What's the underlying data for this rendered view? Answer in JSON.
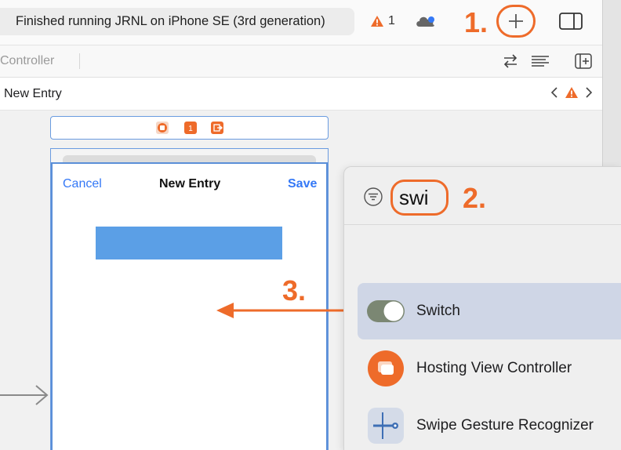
{
  "toolbar": {
    "status": "Finished running JRNL on iPhone SE (3rd generation)",
    "warning_count": "1",
    "plus_icon": "plus-icon",
    "inspector_icon": "sidebar-right-icon"
  },
  "annotations": {
    "step1": "1.",
    "step2": "2.",
    "step3": "3."
  },
  "tabbar": {
    "label": "Controller"
  },
  "jumpbar": {
    "label": "New Entry"
  },
  "scene": {
    "cancel": "Cancel",
    "title": "New Entry",
    "save": "Save"
  },
  "library": {
    "search_value": "swi",
    "items": [
      {
        "label": "Switch",
        "icon": "switch-icon",
        "selected": true
      },
      {
        "label": "Hosting View Controller",
        "icon": "hosting-view-controller-icon",
        "selected": false
      },
      {
        "label": "Swipe Gesture Recognizer",
        "icon": "swipe-gesture-icon",
        "selected": false
      }
    ]
  },
  "colors": {
    "annotation": "#ee6b2a",
    "selection_outline": "#5b8fd8",
    "link_blue": "#3478f6",
    "view_fill": "#5b9fe6",
    "row_selected": "#cfd6e6"
  }
}
